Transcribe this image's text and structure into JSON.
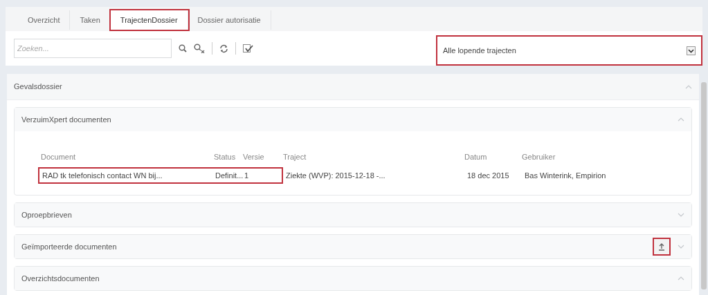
{
  "tabs": [
    {
      "label": "Overzicht",
      "selected": false,
      "highlighted": false
    },
    {
      "label": "Taken",
      "selected": false,
      "highlighted": false
    },
    {
      "label": "TrajectenDossier",
      "selected": true,
      "highlighted": true
    },
    {
      "label": "Dossier autorisatie",
      "selected": false,
      "highlighted": false
    }
  ],
  "toolbar": {
    "search": {
      "placeholder": "Zoeken..."
    },
    "filter": {
      "value": "Alle lopende trajecten",
      "highlighted": true
    }
  },
  "case_file": {
    "title": "Gevalsdossier",
    "expanded": true,
    "sections": [
      {
        "title": "VerzuimXpert documenten",
        "expanded": true,
        "upload": false,
        "table": {
          "columns": [
            "Document",
            "Status",
            "Versie",
            "Traject",
            "Datum",
            "Gebruiker"
          ],
          "rows": [
            {
              "cells": [
                "RAD tk telefonisch contact WN bij...",
                "Definit...",
                "1",
                "Ziekte (WVP): 2015-12-18 -...",
                "18 dec 2015",
                "Bas Winterink, Empirion"
              ],
              "highlighted": true
            }
          ]
        }
      },
      {
        "title": "Oproepbrieven",
        "expanded": false,
        "upload": false
      },
      {
        "title": "Geïmporteerde documenten",
        "expanded": false,
        "upload": true
      },
      {
        "title": "Overzichtsdocumenten",
        "expanded": true,
        "upload": false
      }
    ]
  }
}
